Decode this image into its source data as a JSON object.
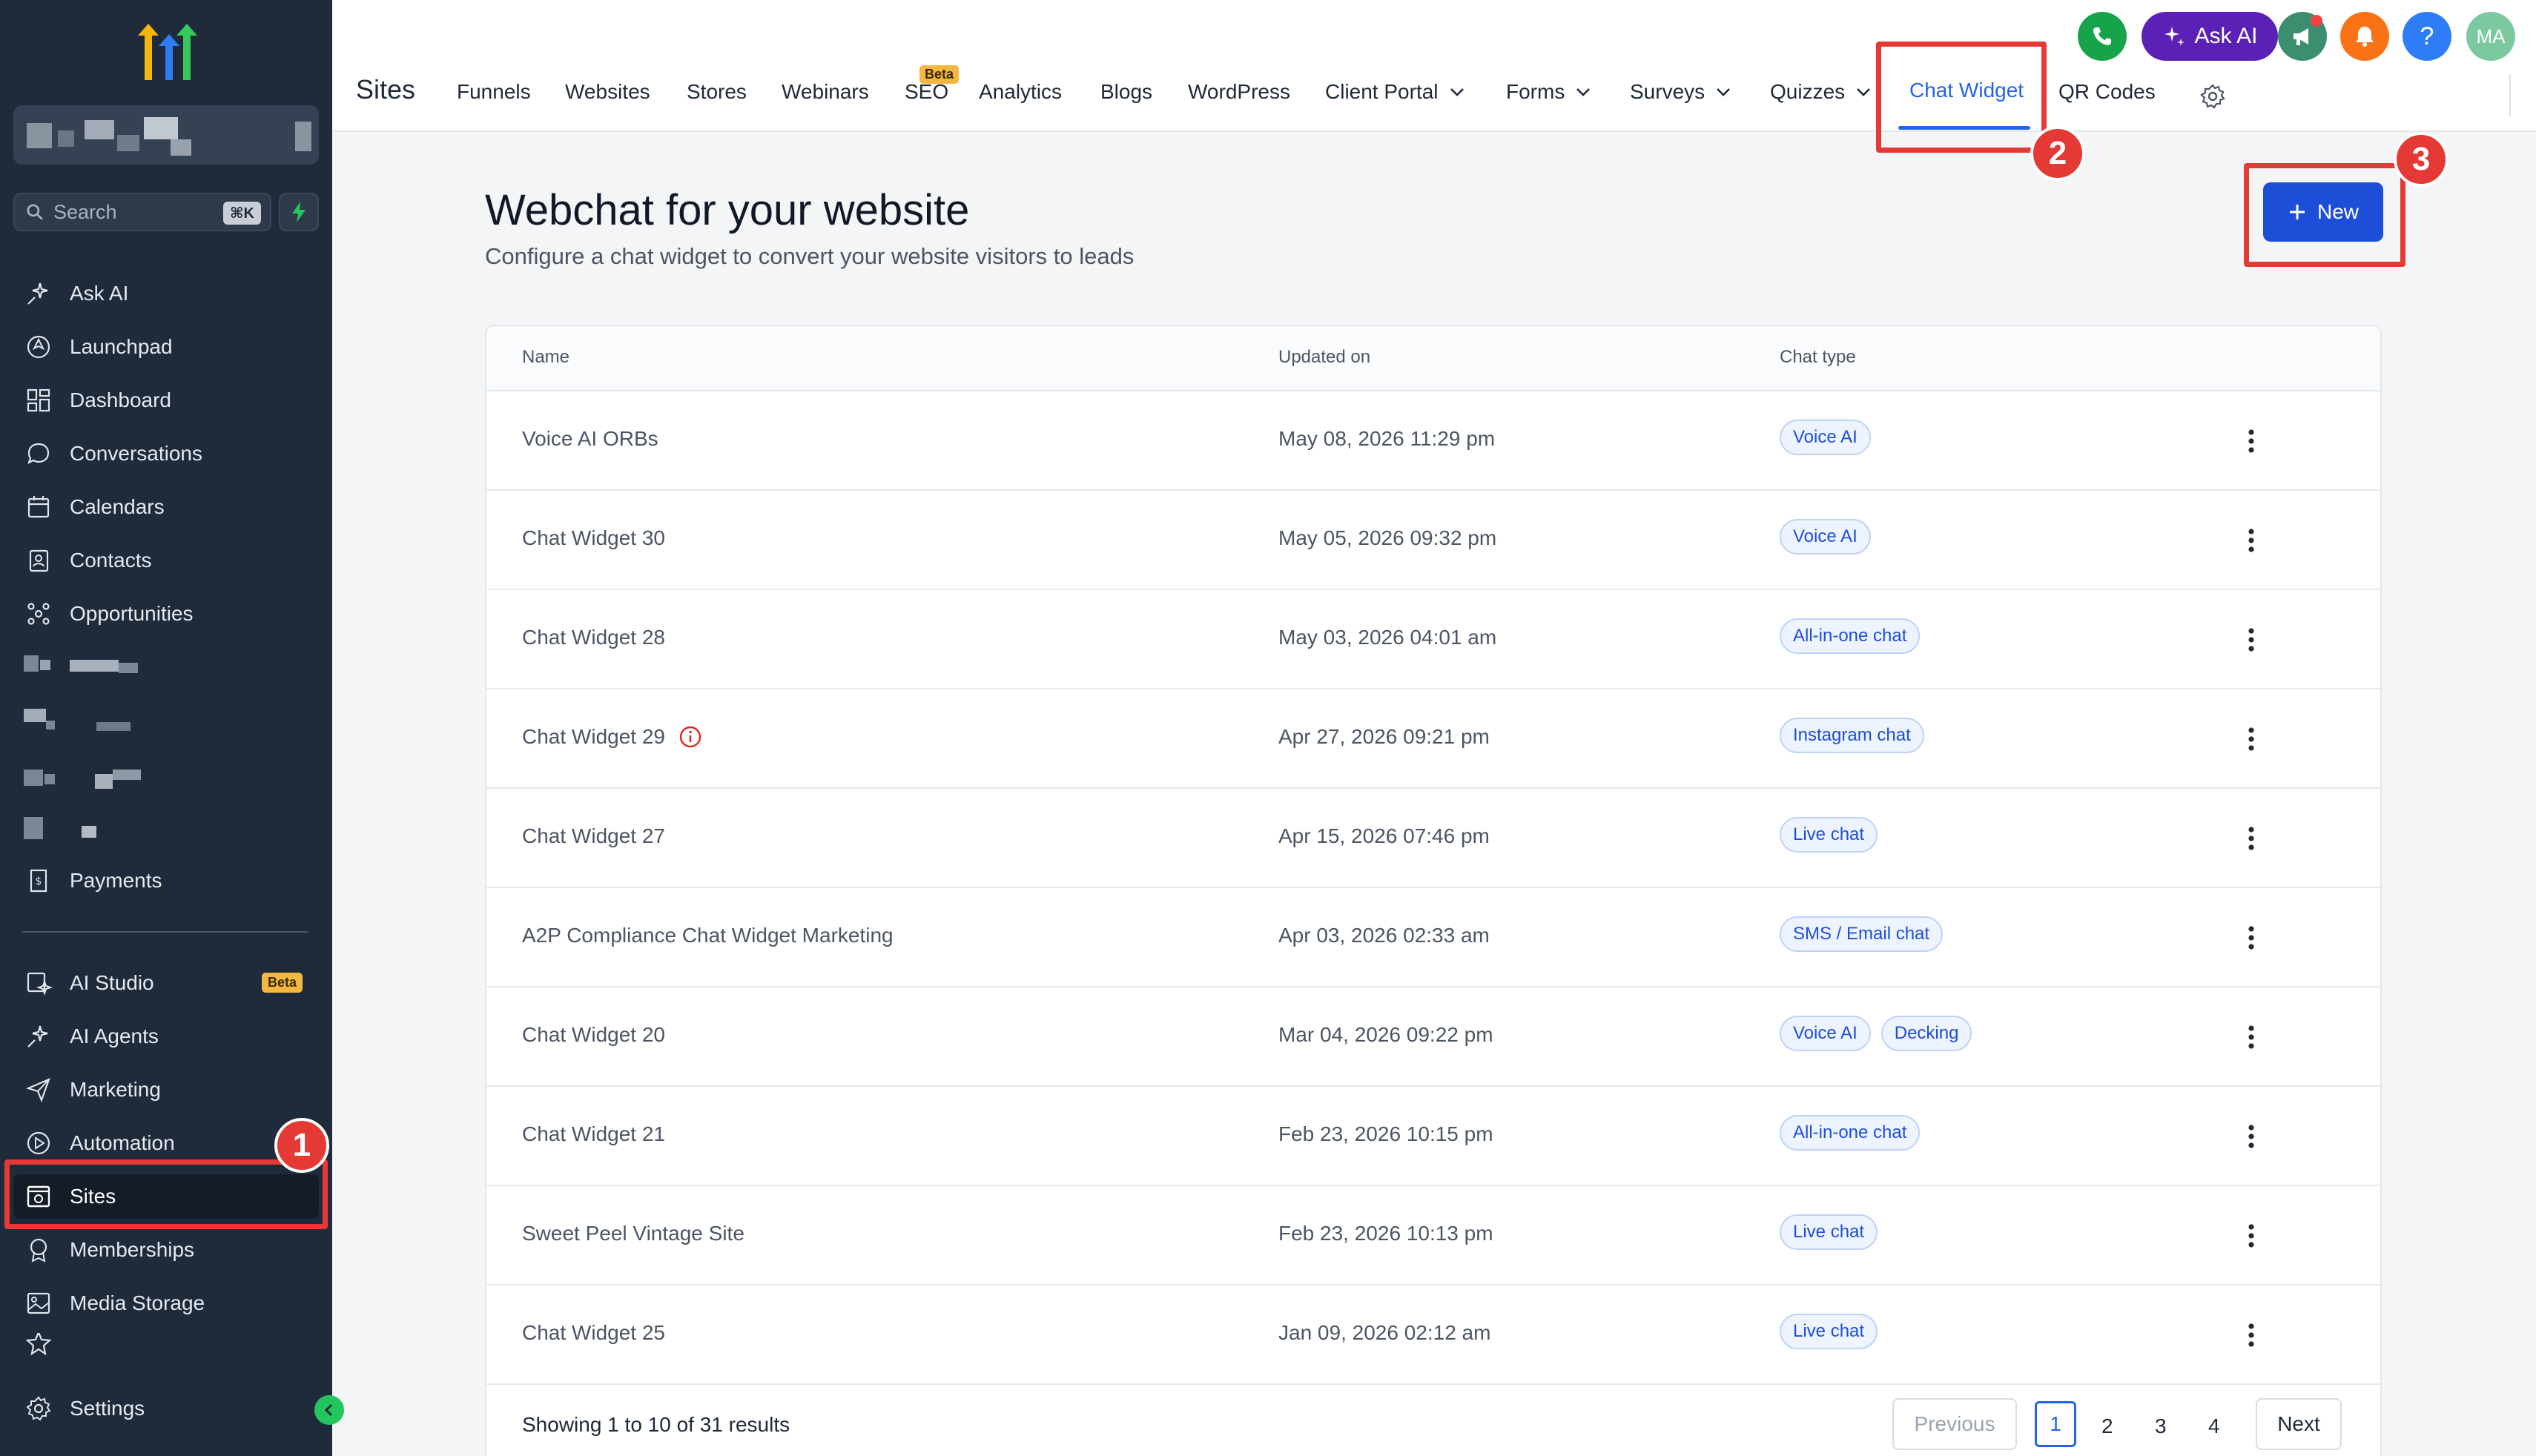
{
  "sidebar": {
    "search_label": "Search",
    "search_shortcut": "⌘K",
    "items_top": [
      {
        "label": "Ask AI",
        "icon": "sparkle-icon"
      },
      {
        "label": "Launchpad",
        "icon": "rocket-icon"
      },
      {
        "label": "Dashboard",
        "icon": "grid-icon"
      },
      {
        "label": "Conversations",
        "icon": "chat-bubble-icon"
      },
      {
        "label": "Calendars",
        "icon": "calendar-icon"
      },
      {
        "label": "Contacts",
        "icon": "contacts-icon"
      },
      {
        "label": "Opportunities",
        "icon": "pipeline-icon"
      }
    ],
    "payments_label": "Payments",
    "items_bottom": [
      {
        "label": "AI Studio",
        "icon": "ai-studio-icon",
        "badge": "Beta"
      },
      {
        "label": "AI Agents",
        "icon": "sparkle-icon"
      },
      {
        "label": "Marketing",
        "icon": "send-icon"
      },
      {
        "label": "Automation",
        "icon": "automation-icon"
      },
      {
        "label": "Sites",
        "icon": "sites-icon"
      },
      {
        "label": "Memberships",
        "icon": "badge-icon"
      },
      {
        "label": "Media Storage",
        "icon": "image-icon"
      }
    ],
    "settings_label": "Settings",
    "active_item": "Sites"
  },
  "topbar": {
    "title": "Sites",
    "tabs": [
      {
        "label": "Funnels"
      },
      {
        "label": "Websites"
      },
      {
        "label": "Stores"
      },
      {
        "label": "Webinars"
      },
      {
        "label": "SEO",
        "badge": "Beta"
      },
      {
        "label": "Analytics"
      },
      {
        "label": "Blogs"
      },
      {
        "label": "WordPress"
      },
      {
        "label": "Client Portal",
        "dropdown": true
      },
      {
        "label": "Forms",
        "dropdown": true
      },
      {
        "label": "Surveys",
        "dropdown": true
      },
      {
        "label": "Quizzes",
        "dropdown": true
      },
      {
        "label": "Chat Widget",
        "active": true
      },
      {
        "label": "QR Codes"
      }
    ],
    "ask_ai_label": "Ask AI",
    "help_label": "?",
    "avatar_initials": "MA"
  },
  "annotations": [
    "1",
    "2",
    "3"
  ],
  "main": {
    "title": "Webchat for your website",
    "subtitle": "Configure a chat widget to convert your website visitors to leads",
    "new_button_label": "New",
    "columns": [
      "Name",
      "Updated on",
      "Chat type"
    ],
    "rows": [
      {
        "name": "Voice AI ORBs",
        "updated": "May 08, 2026 11:29 pm",
        "types": [
          "Voice AI"
        ],
        "warning": false
      },
      {
        "name": "Chat Widget 30",
        "updated": "May 05, 2026 09:32 pm",
        "types": [
          "Voice AI"
        ],
        "warning": false
      },
      {
        "name": "Chat Widget 28",
        "updated": "May 03, 2026 04:01 am",
        "types": [
          "All-in-one chat"
        ],
        "warning": false
      },
      {
        "name": "Chat Widget 29",
        "updated": "Apr 27, 2026 09:21 pm",
        "types": [
          "Instagram chat"
        ],
        "warning": true
      },
      {
        "name": "Chat Widget 27",
        "updated": "Apr 15, 2026 07:46 pm",
        "types": [
          "Live chat"
        ],
        "warning": false
      },
      {
        "name": "A2P Compliance Chat Widget Marketing",
        "updated": "Apr 03, 2026 02:33 am",
        "types": [
          "SMS / Email chat"
        ],
        "warning": false
      },
      {
        "name": "Chat Widget 20",
        "updated": "Mar 04, 2026 09:22 pm",
        "types": [
          "Voice AI",
          "Decking"
        ],
        "warning": false
      },
      {
        "name": "Chat Widget 21",
        "updated": "Feb 23, 2026 10:15 pm",
        "types": [
          "All-in-one chat"
        ],
        "warning": false
      },
      {
        "name": "Sweet Peel Vintage Site",
        "updated": "Feb 23, 2026 10:13 pm",
        "types": [
          "Live chat"
        ],
        "warning": false
      },
      {
        "name": "Chat Widget 25",
        "updated": "Jan 09, 2026 02:12 am",
        "types": [
          "Live chat"
        ],
        "warning": false
      }
    ],
    "results_text": "Showing 1 to 10 of 31 results",
    "pagination": {
      "previous": "Previous",
      "next": "Next",
      "pages": [
        "1",
        "2",
        "3",
        "4"
      ],
      "current": "1"
    }
  },
  "colors": {
    "sidebar_bg": "#1f2b3a",
    "accent": "#2563eb",
    "annotation": "#e53935"
  }
}
